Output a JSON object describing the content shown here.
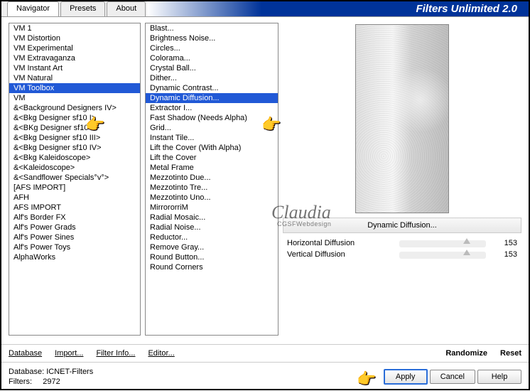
{
  "title": "Filters Unlimited 2.0",
  "tabs": [
    "Navigator",
    "Presets",
    "About"
  ],
  "categories": [
    "VM 1",
    "VM Distortion",
    "VM Experimental",
    "VM Extravaganza",
    "VM Instant Art",
    "VM Natural",
    "VM Toolbox",
    "VM",
    "&<Background Designers IV>",
    "&<Bkg Designer sf10 I>",
    "&<BKg Designer sf10 II>",
    "&<Bkg Designer sf10 III>",
    "&<Bkg Designer sf10 IV>",
    "&<Bkg Kaleidoscope>",
    "&<Kaleidoscope>",
    "&<Sandflower Specials°v°>",
    "[AFS IMPORT]",
    "AFH",
    "AFS IMPORT",
    "Alf's Border FX",
    "Alf's Power Grads",
    "Alf's Power Sines",
    "Alf's Power Toys",
    "AlphaWorks"
  ],
  "categories_selected_index": 6,
  "filters": [
    "Blast...",
    "Brightness Noise...",
    "Circles...",
    "Colorama...",
    "Crystal Ball...",
    "Dither...",
    "Dynamic Contrast...",
    "Dynamic Diffusion...",
    "Extractor I...",
    "Fast Shadow (Needs Alpha)",
    "Grid...",
    "Instant Tile...",
    "Lift the Cover (With Alpha)",
    "Lift the Cover",
    "Metal Frame",
    "Mezzotinto Due...",
    "Mezzotinto Tre...",
    "Mezzotinto Uno...",
    "MirrororriM",
    "Radial Mosaic...",
    "Radial Noise...",
    "Reductor...",
    "Remove Gray...",
    "Round Button...",
    "Round Corners"
  ],
  "filters_selected_index": 7,
  "param_title": "Dynamic Diffusion...",
  "params": [
    {
      "label": "Horizontal Diffusion",
      "value": 153
    },
    {
      "label": "Vertical Diffusion",
      "value": 153
    }
  ],
  "toolbar": {
    "database": "Database",
    "import": "Import...",
    "filter_info": "Filter Info...",
    "editor": "Editor...",
    "randomize": "Randomize",
    "reset": "Reset"
  },
  "footer": {
    "db_label": "Database:",
    "db_value": "ICNET-Filters",
    "filters_label": "Filters:",
    "filters_value": "2972",
    "apply": "Apply",
    "cancel": "Cancel",
    "help": "Help"
  },
  "watermark": "Claudia",
  "watermark_sub": "CGSFWebdesign"
}
